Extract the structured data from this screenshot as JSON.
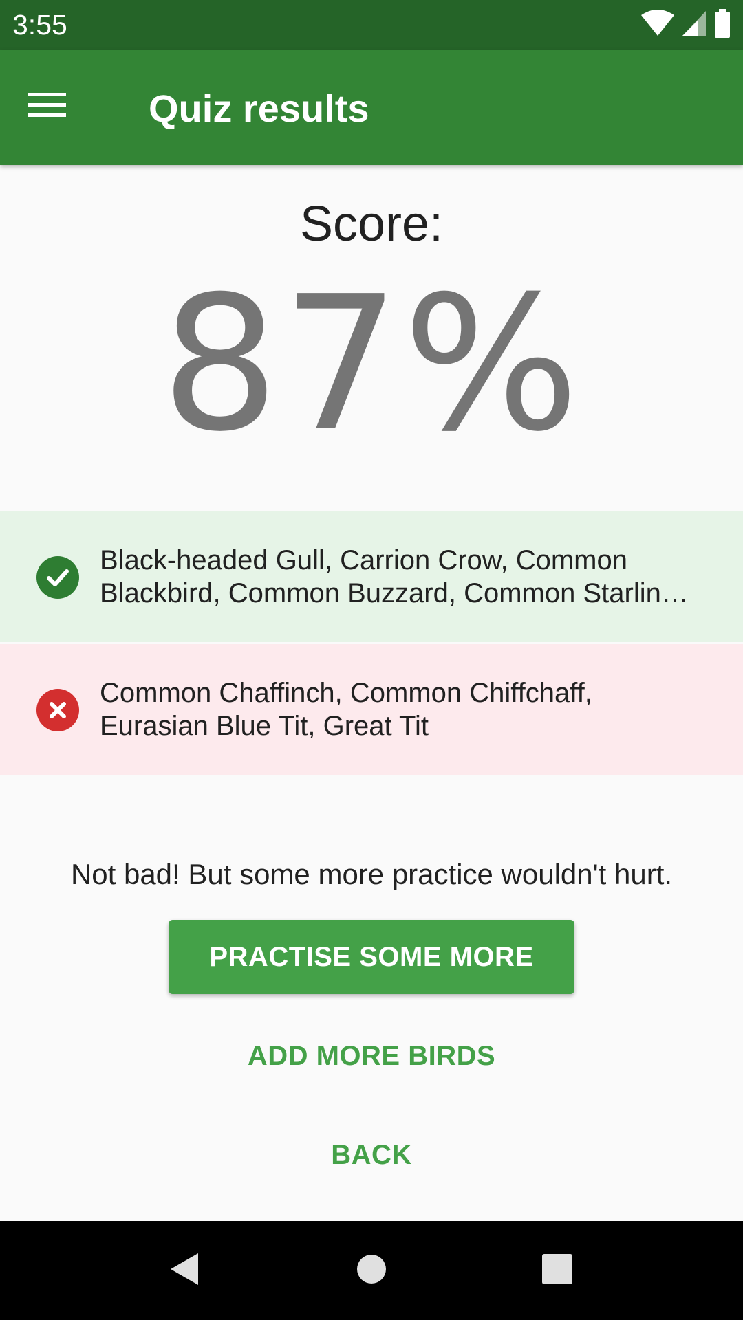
{
  "status_bar": {
    "time": "3:55",
    "icons": [
      "wifi-icon",
      "cell-signal-icon",
      "battery-icon"
    ]
  },
  "app_bar": {
    "menu_icon": "menu-icon",
    "title": "Quiz results"
  },
  "score": {
    "label": "Score:",
    "value": "87%"
  },
  "results": {
    "correct": {
      "icon": "check-circle-icon",
      "text": "Black-headed Gull, Carrion Crow, Common Blackbird, Common Buzzard, Common Starlin…"
    },
    "wrong": {
      "icon": "x-circle-icon",
      "text": "Common Chaffinch, Common Chiffchaff, Eurasian Blue Tit, Great Tit"
    }
  },
  "message": "Not bad! But some more practice wouldn't hurt.",
  "buttons": {
    "practise": "PRACTISE SOME MORE",
    "add_birds": "ADD MORE BIRDS",
    "back": "BACK"
  },
  "nav": {
    "back_icon": "nav-back-icon",
    "home_icon": "nav-home-icon",
    "recent_icon": "nav-recent-icon"
  },
  "colors": {
    "status_bar": "#256428",
    "app_bar": "#338535",
    "accent": "#44a148",
    "correct_bg": "#e6f4e7",
    "wrong_bg": "#fdeaed",
    "correct_icon": "#2e7d32",
    "wrong_icon": "#d32f2f"
  }
}
